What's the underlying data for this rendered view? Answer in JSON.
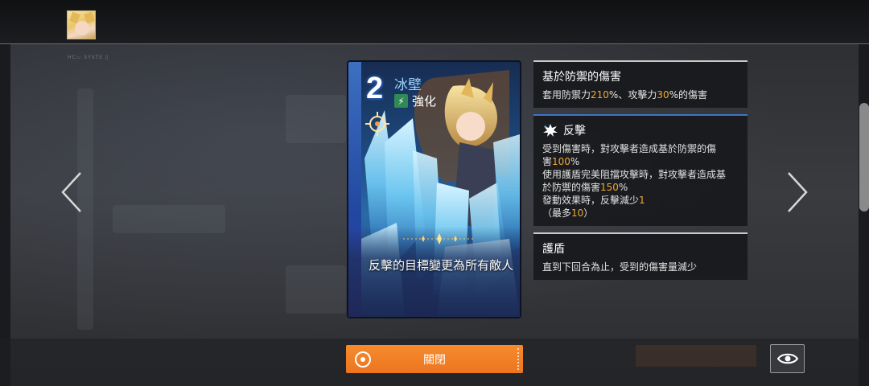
{
  "header": {
    "avatar_name": "player-avatar",
    "small_label": "HC▭ SYSTE ▯"
  },
  "card": {
    "cost": "2",
    "name": "冰壁",
    "tag": "強化",
    "tag_icon": "lightning-icon",
    "description": "反擊的目標變更為所有敵人"
  },
  "info": [
    {
      "title": "基於防禦的傷害",
      "lines": [
        [
          {
            "t": "套用防禦力"
          },
          {
            "t": "210",
            "num": true
          },
          {
            "t": "%、攻擊力"
          },
          {
            "t": "30",
            "num": true
          },
          {
            "t": "%的傷害"
          }
        ]
      ]
    },
    {
      "title": "反擊",
      "icon": "counter-burst-icon",
      "lines": [
        [
          {
            "t": "受到傷害時，對攻擊者造成基於防禦的傷"
          }
        ],
        [
          {
            "t": "害"
          },
          {
            "t": "100",
            "num": true
          },
          {
            "t": "%"
          }
        ],
        [
          {
            "t": "使用護盾完美阻擋攻擊時，對攻擊者造成基"
          }
        ],
        [
          {
            "t": "於防禦的傷害"
          },
          {
            "t": "150",
            "num": true
          },
          {
            "t": "%"
          }
        ],
        [
          {
            "t": "發動效果時，反擊減少"
          },
          {
            "t": "1",
            "num": true
          }
        ],
        [
          {
            "t": "（最多"
          },
          {
            "t": "10",
            "num": true
          },
          {
            "t": "）"
          }
        ]
      ]
    },
    {
      "title": "護盾",
      "lines": [
        [
          {
            "t": "直到下回合為止，受到的傷害量減少"
          }
        ]
      ]
    }
  ],
  "buttons": {
    "close_label": "關閉",
    "view_icon": "eye-icon"
  },
  "colors": {
    "accent_orange": "#f28226",
    "number_highlight": "#f2a830",
    "card_name_blue": "#9ad2ff"
  }
}
